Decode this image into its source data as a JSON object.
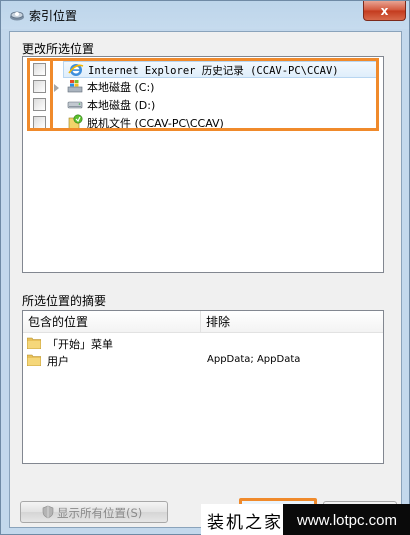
{
  "window": {
    "title": "索引位置",
    "close_label": "x",
    "icon": "search-index-icon"
  },
  "change_locations": {
    "label": "更改所选位置",
    "items": [
      {
        "label": "Internet Explorer 历史记录 (CCAV-PC\\CCAV)",
        "icon": "internet-explorer-icon",
        "checked": false,
        "expandable": false,
        "selected": true
      },
      {
        "label": "本地磁盘 (C:)",
        "icon": "windows-drive-icon",
        "checked": false,
        "expandable": true,
        "selected": false
      },
      {
        "label": "本地磁盘 (D:)",
        "icon": "drive-icon",
        "checked": false,
        "expandable": false,
        "selected": false
      },
      {
        "label": "脱机文件 (CCAV-PC\\CCAV)",
        "icon": "offline-files-icon",
        "checked": false,
        "expandable": false,
        "selected": false
      }
    ]
  },
  "summary": {
    "label": "所选位置的摘要",
    "columns": [
      "包含的位置",
      "排除"
    ],
    "rows": [
      {
        "location": "「开始」菜单",
        "exclude": "",
        "icon": "folder-icon"
      },
      {
        "location": "用户",
        "exclude": "AppData; AppData",
        "icon": "folder-icon"
      }
    ]
  },
  "buttons": {
    "show_all": "显示所有位置(S)",
    "show_all_icon": "shield-icon"
  },
  "watermark": {
    "left": "装机之家",
    "right": "www.lotpc.com"
  },
  "colors": {
    "highlight": "#f08a2b",
    "selection": "#dfeefb"
  }
}
